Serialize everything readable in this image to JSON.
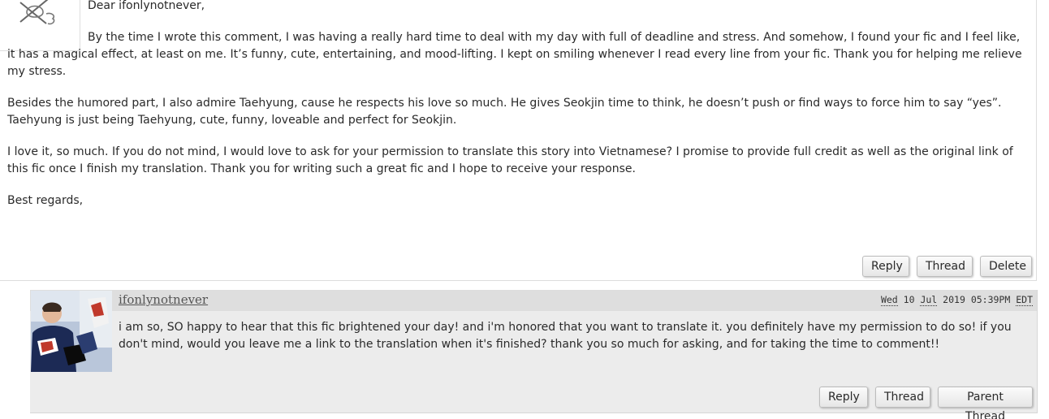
{
  "comment1": {
    "salutation": "Dear ifonlynotnever,",
    "paragraphs": [
      "By the time I wrote this comment, I was having a really hard time to deal with my day with full of deadline and stress. And somehow, I found your fic and I feel like, it has a magical effect, at least on me. It’s funny, cute, entertaining, and mood-lifting. I kept on smiling whenever I read every line from your fic. Thank you for helping me relieve my stress.",
      "Besides the humored part, I also admire Taehyung, cause he respects his love so much. He gives Seokjin time to think, he doesn’t push or find ways to force him to say “yes”. Taehyung is just being Taehyung, cute, funny, loveable and perfect for Seokjin.",
      "I love it, so much. If you do not mind, I would love to ask for your permission to translate this story into Vietnamese? I promise to provide full credit as well as the original link of this fic once I finish my translation. Thank you for writing such a great fic and I hope to receive your response.",
      "Best regards,"
    ],
    "buttons": {
      "reply": "Reply",
      "thread": "Thread",
      "delete": "Delete"
    }
  },
  "comment2": {
    "author": "ifonlynotnever",
    "timestamp": {
      "day": "Wed",
      "date": "10",
      "month": "Jul",
      "year": "2019",
      "time": "05:39PM",
      "zone": "EDT"
    },
    "text": "i am so, SO happy to hear that this fic brightened your day! and i'm honored that you want to translate it. you definitely have my permission to do so! if you don't mind, would you leave me a link to the translation when it's finished? thank you so much for asking, and for taking the time to comment!!",
    "buttons": {
      "reply": "Reply",
      "thread": "Thread",
      "parent_thread": "Parent Thread"
    }
  },
  "colors": {
    "reply_background": "#ececec",
    "reply_header": "#dedede",
    "button_border": "#bcbcbc"
  }
}
